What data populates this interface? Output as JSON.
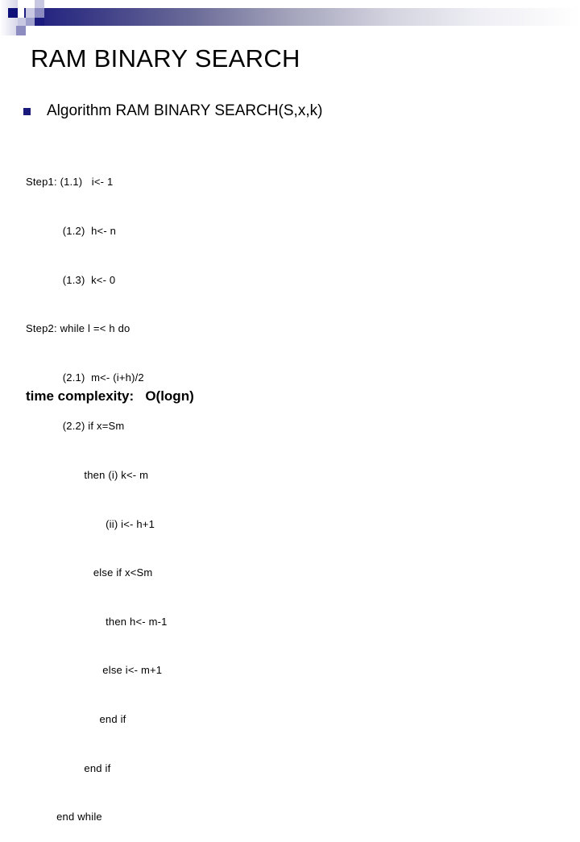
{
  "slide": {
    "title": "RAM BINARY SEARCH",
    "bullet": {
      "icon": "square-bullet-icon",
      "text": "Algorithm RAM BINARY SEARCH(S,x,k)"
    },
    "pseudocode": [
      "Step1: (1.1)   i<- 1",
      "            (1.2)  h<- n",
      "            (1.3)  k<- 0",
      "Step2: while l =< h do",
      "            (2.1)  m<- (i+h)/2",
      "            (2.2) if x=Sm",
      "                   then (i) k<- m",
      "                          (ii) i<- h+1",
      "                      else if x<Sm",
      "                          then h<- m-1",
      "                         else i<- m+1",
      "                        end if",
      "                   end if",
      "          end while"
    ],
    "complexity": "time complexity:   O(logn)",
    "colors": {
      "accent_dark": "#1c1c80",
      "accent_mid": "#8c8cc0",
      "accent_light": "#c8c8e2"
    }
  }
}
